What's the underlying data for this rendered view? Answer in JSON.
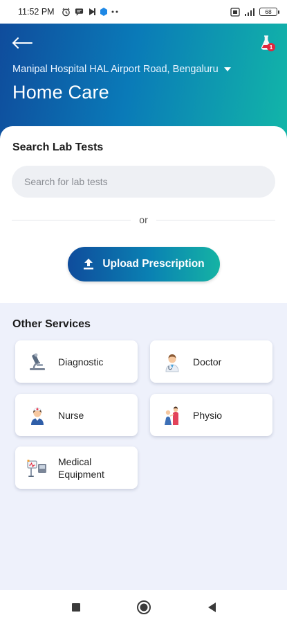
{
  "status_bar": {
    "time": "11:52 PM",
    "battery": "68"
  },
  "header": {
    "location": "Manipal Hospital HAL Airport Road, Bengaluru",
    "title": "Home Care",
    "cart_count": "1"
  },
  "search": {
    "title": "Search Lab Tests",
    "placeholder": "Search for lab tests",
    "or_text": "or",
    "upload_label": "Upload Prescription"
  },
  "services": {
    "title": "Other Services",
    "items": [
      {
        "label": "Diagnostic",
        "icon": "microscope-icon"
      },
      {
        "label": "Doctor",
        "icon": "doctor-icon"
      },
      {
        "label": "Nurse",
        "icon": "nurse-icon"
      },
      {
        "label": "Physio",
        "icon": "physio-icon"
      },
      {
        "label": "Medical\nEquipment",
        "icon": "medical-equipment-icon"
      }
    ]
  },
  "colors": {
    "header_start": "#0f4c9c",
    "header_end": "#12b6a8",
    "background": "#eef1fb"
  }
}
